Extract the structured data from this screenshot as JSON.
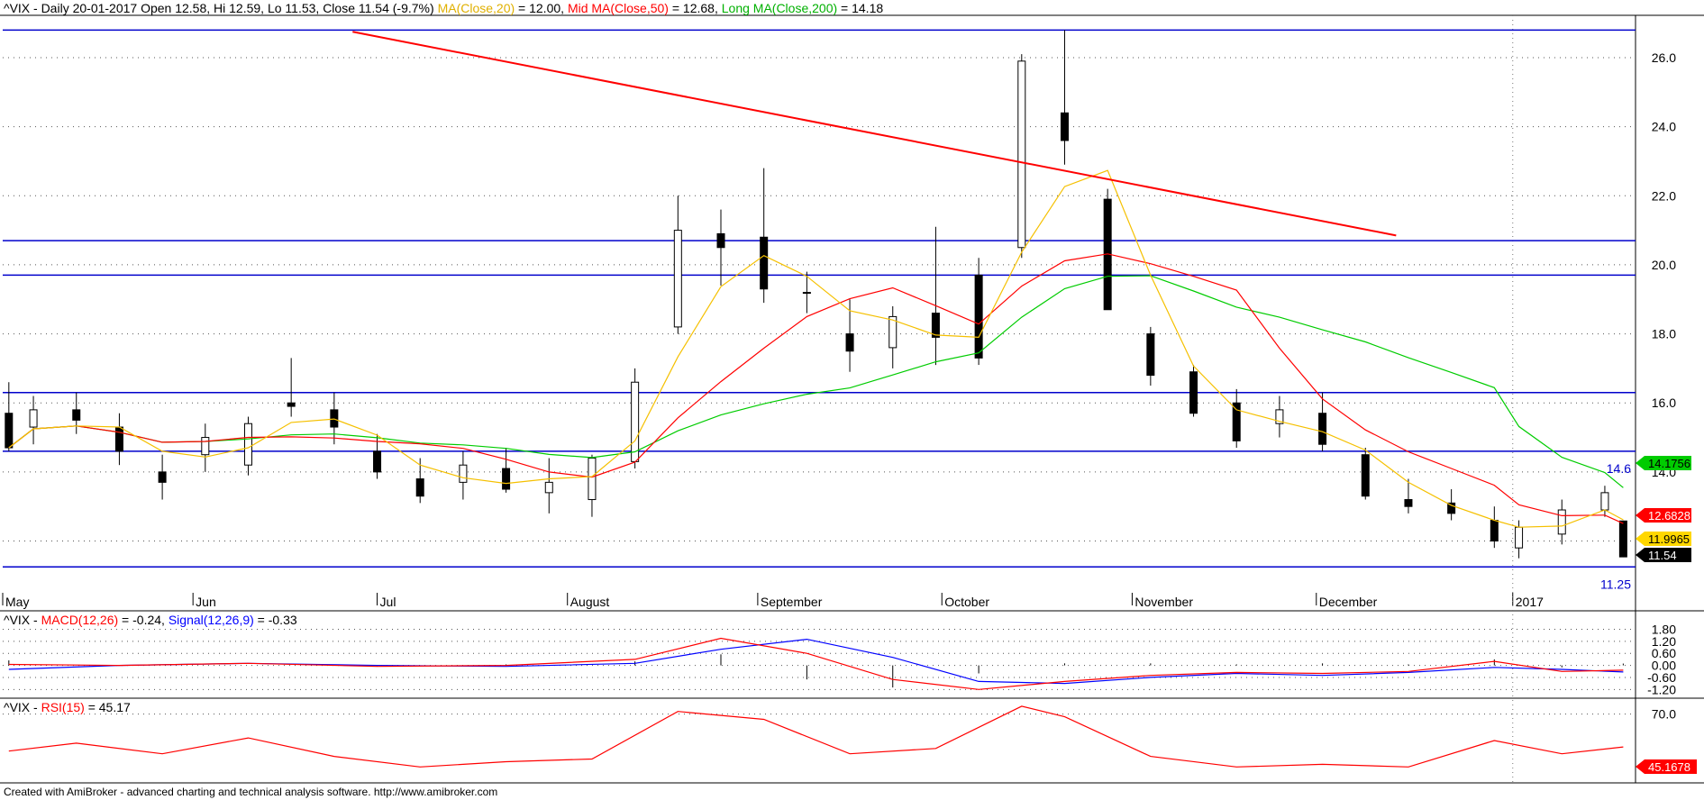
{
  "header": {
    "main": {
      "prefix": "^VIX - Daily 20-01-2017 Open 12.58, Hi 12.59, Lo 11.53, Close 11.54 (-9.7%) ",
      "ma20_label": "MA(Close,20)",
      "ma20_value": " = 12.00, ",
      "ma50_label": "Mid MA(Close,50)",
      "ma50_value": " = 12.68, ",
      "ma200_label": "Long MA(Close,200)",
      "ma200_value": " = 14.18"
    },
    "macd": {
      "prefix": "^VIX - ",
      "macd_label": "MACD(12,26)",
      "macd_value": " = -0.24, ",
      "signal_label": "Signal(12,26,9)",
      "signal_value": " = -0.33"
    },
    "rsi": {
      "prefix": "^VIX - ",
      "rsi_label": "RSI(15)",
      "rsi_value": " = 45.17"
    }
  },
  "footer": "Created with AmiBroker - advanced charting and technical analysis software. http://www.amibroker.com",
  "colors": {
    "ma20": "#f5c000",
    "ma50": "#ff0000",
    "ma200": "#00cc00",
    "macd": "#ff0000",
    "signal": "#0000ff",
    "rsi": "#ff0000",
    "hline": "#0000cc",
    "trend": "#ff0000"
  },
  "chart_data": [
    {
      "type": "candlestick",
      "ylim": [
        10.5,
        27.2
      ],
      "y_ticks": [
        "26.0",
        "24.0",
        "22.0",
        "20.0",
        "18.0",
        "16.0",
        "14.0",
        "12.0"
      ],
      "x_labels": [
        "May",
        "Jun",
        "Jul",
        "August",
        "September",
        "October",
        "November",
        "December",
        "2017"
      ],
      "horizontal_lines": [
        {
          "value": 26.8
        },
        {
          "value": 20.7
        },
        {
          "value": 19.7
        },
        {
          "value": 16.3
        },
        {
          "value": 14.6,
          "label": "14.6"
        },
        {
          "value": 11.25,
          "label": "11.25"
        }
      ],
      "trendline": {
        "from": [
          "2016-06-27",
          26.75
        ],
        "to": [
          "2016-12-14",
          20.85
        ]
      },
      "last_value_tags": [
        {
          "value": "14.1756",
          "series": "ma200"
        },
        {
          "value": "12.6828",
          "series": "ma50"
        },
        {
          "value": "11.9965",
          "series": "ma20"
        },
        {
          "value": "11.54",
          "series": "close"
        }
      ],
      "candles": [
        {
          "date": "2016-05-02",
          "o": 15.7,
          "h": 16.6,
          "l": 14.6,
          "c": 14.7
        },
        {
          "date": "2016-05-06",
          "o": 15.3,
          "h": 16.2,
          "l": 14.8,
          "c": 15.8
        },
        {
          "date": "2016-05-13",
          "o": 15.8,
          "h": 16.3,
          "l": 15.1,
          "c": 15.5
        },
        {
          "date": "2016-05-20",
          "o": 15.3,
          "h": 15.7,
          "l": 14.2,
          "c": 14.6
        },
        {
          "date": "2016-05-27",
          "o": 14.0,
          "h": 14.5,
          "l": 13.2,
          "c": 13.7
        },
        {
          "date": "2016-06-03",
          "o": 14.5,
          "h": 15.4,
          "l": 14.0,
          "c": 15.0
        },
        {
          "date": "2016-06-10",
          "o": 14.2,
          "h": 15.6,
          "l": 13.9,
          "c": 15.4
        },
        {
          "date": "2016-06-17",
          "o": 16.0,
          "h": 17.3,
          "l": 15.6,
          "c": 15.9
        },
        {
          "date": "2016-06-24",
          "o": 15.8,
          "h": 16.3,
          "l": 14.8,
          "c": 15.3
        },
        {
          "date": "2016-07-01",
          "o": 14.6,
          "h": 15.1,
          "l": 13.8,
          "c": 14.0
        },
        {
          "date": "2016-07-08",
          "o": 13.8,
          "h": 14.4,
          "l": 13.1,
          "c": 13.3
        },
        {
          "date": "2016-07-15",
          "o": 13.7,
          "h": 14.6,
          "l": 13.2,
          "c": 14.2
        },
        {
          "date": "2016-07-22",
          "o": 14.1,
          "h": 14.7,
          "l": 13.4,
          "c": 13.5
        },
        {
          "date": "2016-07-29",
          "o": 13.4,
          "h": 14.4,
          "l": 12.8,
          "c": 13.7
        },
        {
          "date": "2016-08-05",
          "o": 13.2,
          "h": 14.5,
          "l": 12.7,
          "c": 14.4
        },
        {
          "date": "2016-08-12",
          "o": 14.3,
          "h": 17.0,
          "l": 14.1,
          "c": 16.6
        },
        {
          "date": "2016-08-19",
          "o": 18.2,
          "h": 22.0,
          "l": 18.0,
          "c": 21.0
        },
        {
          "date": "2016-08-26",
          "o": 20.9,
          "h": 21.6,
          "l": 19.4,
          "c": 20.5
        },
        {
          "date": "2016-09-02",
          "o": 20.8,
          "h": 22.8,
          "l": 18.9,
          "c": 19.3
        },
        {
          "date": "2016-09-09",
          "o": 19.2,
          "h": 19.8,
          "l": 18.6,
          "c": 19.2
        },
        {
          "date": "2016-09-16",
          "o": 18.0,
          "h": 19.0,
          "l": 16.9,
          "c": 17.5
        },
        {
          "date": "2016-09-23",
          "o": 17.6,
          "h": 18.8,
          "l": 17.0,
          "c": 18.5
        },
        {
          "date": "2016-09-30",
          "o": 18.6,
          "h": 21.1,
          "l": 17.1,
          "c": 17.9
        },
        {
          "date": "2016-10-07",
          "o": 19.7,
          "h": 20.2,
          "l": 17.1,
          "c": 17.3
        },
        {
          "date": "2016-10-14",
          "o": 20.5,
          "h": 26.1,
          "l": 20.2,
          "c": 25.9
        },
        {
          "date": "2016-10-21",
          "o": 24.4,
          "h": 26.8,
          "l": 22.9,
          "c": 23.6
        },
        {
          "date": "2016-10-28",
          "o": 21.9,
          "h": 22.2,
          "l": 18.7,
          "c": 18.7
        },
        {
          "date": "2016-11-04",
          "o": 18.0,
          "h": 18.2,
          "l": 16.5,
          "c": 16.8
        },
        {
          "date": "2016-11-11",
          "o": 16.9,
          "h": 17.1,
          "l": 15.6,
          "c": 15.7
        },
        {
          "date": "2016-11-18",
          "o": 16.0,
          "h": 16.4,
          "l": 14.7,
          "c": 14.9
        },
        {
          "date": "2016-11-25",
          "o": 15.4,
          "h": 16.2,
          "l": 15.0,
          "c": 15.8
        },
        {
          "date": "2016-12-02",
          "o": 15.7,
          "h": 16.3,
          "l": 14.6,
          "c": 14.8
        },
        {
          "date": "2016-12-09",
          "o": 14.5,
          "h": 14.7,
          "l": 13.2,
          "c": 13.3
        },
        {
          "date": "2016-12-16",
          "o": 13.2,
          "h": 13.8,
          "l": 12.8,
          "c": 13.0
        },
        {
          "date": "2016-12-23",
          "o": 13.1,
          "h": 13.5,
          "l": 12.6,
          "c": 12.8
        },
        {
          "date": "2016-12-30",
          "o": 12.6,
          "h": 13.0,
          "l": 11.8,
          "c": 12.0
        },
        {
          "date": "2017-01-03",
          "o": 11.8,
          "h": 12.6,
          "l": 11.5,
          "c": 12.4
        },
        {
          "date": "2017-01-10",
          "o": 12.2,
          "h": 13.2,
          "l": 11.9,
          "c": 12.9
        },
        {
          "date": "2017-01-17",
          "o": 12.9,
          "h": 13.6,
          "l": 12.7,
          "c": 13.4
        },
        {
          "date": "2017-01-20",
          "o": 12.58,
          "h": 12.59,
          "l": 11.53,
          "c": 11.54
        }
      ]
    },
    {
      "type": "line",
      "title": "MACD(12,26)",
      "ylim": [
        -1.5,
        2.0
      ],
      "y_ticks": [
        "1.80",
        "1.20",
        "0.60",
        "0.00",
        "-0.60",
        "-1.20"
      ],
      "series": [
        {
          "name": "MACD(12,26)",
          "color_key": "macd",
          "x": [
            "2016-05-02",
            "2016-05-20",
            "2016-06-10",
            "2016-07-01",
            "2016-07-22",
            "2016-08-12",
            "2016-08-26",
            "2016-09-09",
            "2016-09-23",
            "2016-10-07",
            "2016-10-21",
            "2016-11-04",
            "2016-11-18",
            "2016-12-02",
            "2016-12-16",
            "2016-12-30",
            "2017-01-10",
            "2017-01-20"
          ],
          "values": [
            0.05,
            0.0,
            0.1,
            -0.05,
            0.0,
            0.3,
            1.35,
            0.6,
            -0.7,
            -1.2,
            -0.8,
            -0.5,
            -0.35,
            -0.4,
            -0.3,
            0.2,
            -0.3,
            -0.24
          ]
        },
        {
          "name": "Signal(12,26,9)",
          "color_key": "signal",
          "x": [
            "2016-05-02",
            "2016-05-20",
            "2016-06-10",
            "2016-07-01",
            "2016-07-22",
            "2016-08-12",
            "2016-08-26",
            "2016-09-09",
            "2016-09-23",
            "2016-10-07",
            "2016-10-21",
            "2016-11-04",
            "2016-11-18",
            "2016-12-02",
            "2016-12-16",
            "2016-12-30",
            "2017-01-10",
            "2017-01-20"
          ],
          "values": [
            -0.2,
            0.0,
            0.1,
            0.0,
            -0.05,
            0.1,
            0.8,
            1.3,
            0.4,
            -0.8,
            -0.9,
            -0.6,
            -0.4,
            -0.5,
            -0.35,
            -0.1,
            -0.2,
            -0.33
          ]
        }
      ]
    },
    {
      "type": "line",
      "title": "RSI(15)",
      "ylim": [
        20,
        80
      ],
      "y_ticks": [
        "70.0"
      ],
      "last_value_tag": "45.1678",
      "series": [
        {
          "name": "RSI(15)",
          "color_key": "rsi",
          "x": [
            "2016-05-02",
            "2016-05-13",
            "2016-05-27",
            "2016-06-10",
            "2016-06-24",
            "2016-07-08",
            "2016-07-22",
            "2016-08-05",
            "2016-08-19",
            "2016-09-02",
            "2016-09-16",
            "2016-09-30",
            "2016-10-14",
            "2016-10-21",
            "2016-11-04",
            "2016-11-18",
            "2016-12-02",
            "2016-12-16",
            "2016-12-30",
            "2017-01-10",
            "2017-01-20"
          ],
          "values": [
            42,
            48,
            40,
            52,
            38,
            30,
            34,
            36,
            72,
            66,
            40,
            44,
            76,
            68,
            38,
            30,
            32,
            30,
            50,
            40,
            45.17
          ]
        }
      ]
    }
  ]
}
